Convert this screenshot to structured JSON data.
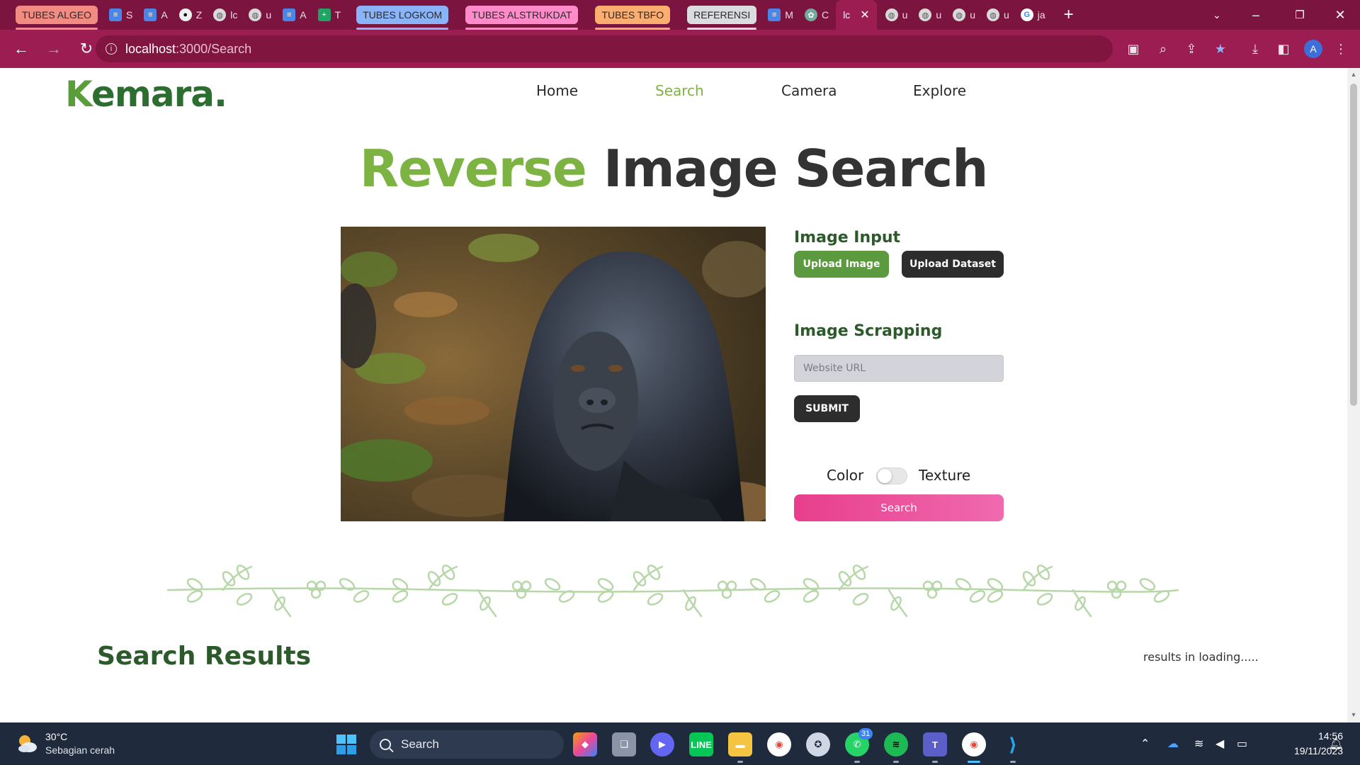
{
  "browser": {
    "tab_groups": [
      {
        "label": "TUBES ALGEO",
        "color": "#f28b82"
      },
      {
        "label": "TUBES LOGKOM",
        "color": "#8ab4f8"
      },
      {
        "label": "TUBES ALSTRUKDAT",
        "color": "#ff8bcb"
      },
      {
        "label": "TUBES TBFO",
        "color": "#fcad70"
      },
      {
        "label": "REFERENSI",
        "color": "#dadce0"
      }
    ],
    "tabs": [
      {
        "letter": "S",
        "icon": "docs-icon"
      },
      {
        "letter": "A",
        "icon": "docs-icon"
      },
      {
        "letter": "Z",
        "icon": "github-icon"
      },
      {
        "letter": "lc",
        "icon": "globe-icon"
      },
      {
        "letter": "u",
        "icon": "globe-icon"
      },
      {
        "letter": "A",
        "icon": "docs-icon"
      },
      {
        "letter": "T",
        "icon": "sheets-icon"
      },
      {
        "letter": "M",
        "icon": "docs-icon"
      },
      {
        "letter": "C",
        "icon": "chatgpt-icon"
      },
      {
        "letter": "u",
        "icon": "globe-icon"
      },
      {
        "letter": "u",
        "icon": "globe-icon"
      },
      {
        "letter": "u",
        "icon": "globe-icon"
      },
      {
        "letter": "u",
        "icon": "globe-icon"
      },
      {
        "letter": "ja",
        "icon": "google-icon"
      }
    ],
    "active_tab": {
      "letter": "lc",
      "close": "✕"
    },
    "new_tab": "+",
    "url_host": "localhost",
    "url_path": ":3000/Search",
    "profile_initial": "A"
  },
  "site": {
    "logo_k": "K",
    "logo_rest": "emara.",
    "nav": [
      {
        "label": "Home"
      },
      {
        "label": "Search",
        "active": true
      },
      {
        "label": "Camera"
      },
      {
        "label": "Explore"
      }
    ]
  },
  "hero": {
    "accent": "Reverse",
    "rest": " Image Search"
  },
  "controls": {
    "image_input_title": "Image Input",
    "upload_image": "Upload Image",
    "upload_dataset": "Upload Dataset",
    "scrapping_title": "Image Scrapping",
    "url_placeholder": "Website URL",
    "url_value": "",
    "submit": "SUBMIT",
    "toggle_left": "Color",
    "toggle_right": "Texture",
    "toggle_on": false,
    "search": "Search"
  },
  "results": {
    "title": "Search Results",
    "status": "results in loading....."
  },
  "taskbar": {
    "weather_temp": "30°C",
    "weather_desc": "Sebagian cerah",
    "search_label": "Search",
    "whatsapp_badge": "31",
    "time": "14:56",
    "date": "19/11/2023"
  },
  "colors": {
    "accent_green": "#7cb342",
    "dark_green": "#2d5a2a",
    "pink": "#e83e8c",
    "chrome": "#9b1d52"
  }
}
